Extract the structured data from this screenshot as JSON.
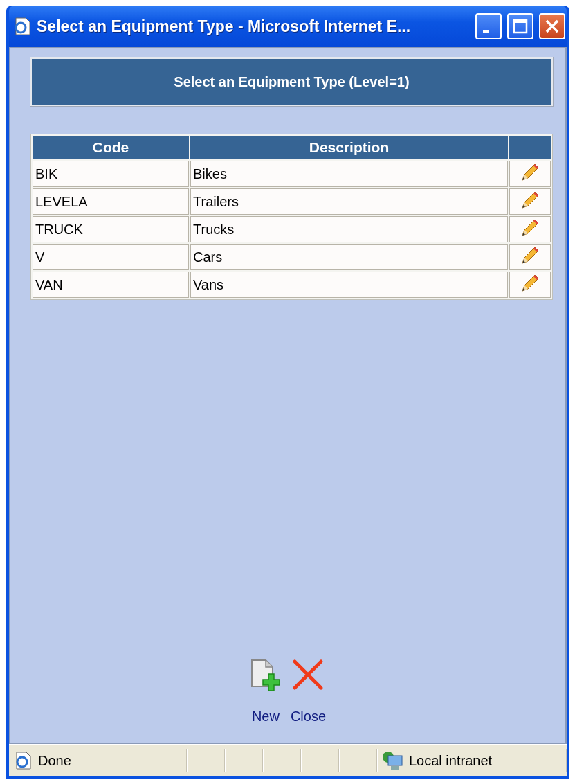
{
  "window": {
    "title": "Select an Equipment Type - Microsoft Internet E..."
  },
  "heading": "Select an Equipment Type (Level=1)",
  "table": {
    "columns": [
      "Code",
      "Description"
    ],
    "rows": [
      {
        "code": "BIK",
        "description": "Bikes"
      },
      {
        "code": "LEVELA",
        "description": "Trailers"
      },
      {
        "code": "TRUCK",
        "description": "Trucks"
      },
      {
        "code": "V",
        "description": "Cars"
      },
      {
        "code": "VAN",
        "description": "Vans"
      }
    ]
  },
  "actions": [
    {
      "kind": "new",
      "label": "New"
    },
    {
      "kind": "close",
      "label": "Close"
    }
  ],
  "status_bar": {
    "status": "Done",
    "zone": "Local intranet"
  }
}
